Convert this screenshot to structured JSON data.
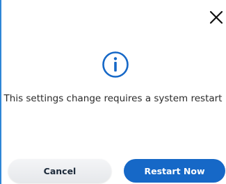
{
  "dialog": {
    "message": "This settings change requires a system restart",
    "info_icon": "info-circle-icon",
    "close_icon": "close-x-icon",
    "cancel_label": "Cancel",
    "restart_label": "Restart Now"
  },
  "colors": {
    "accent": "#1668c7",
    "border": "#2f86d6",
    "cancel_bg": "#eceef1",
    "text": "#2a2a2a"
  }
}
